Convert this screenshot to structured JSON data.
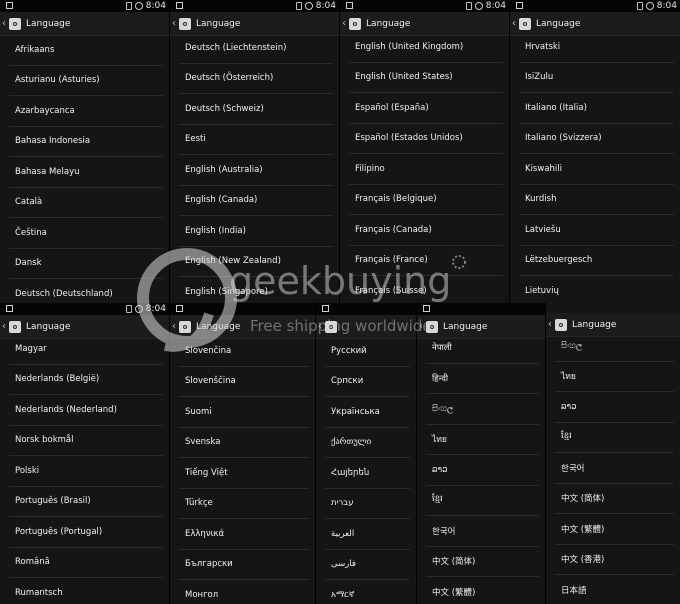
{
  "status": {
    "time": "8:04"
  },
  "actionbar": {
    "title": "Language"
  },
  "panels": [
    {
      "id": "p1",
      "items": [
        "Afrikaans",
        "Asturianu (Asturies)",
        "Azarbaycanca",
        "Bahasa Indonesia",
        "Bahasa Melayu",
        "Català",
        "Čeština",
        "Dansk",
        "Deutsch (Deutschland)"
      ]
    },
    {
      "id": "p2",
      "items": [
        "Deutsch (Liechtenstein)",
        "Deutsch (Österreich)",
        "Deutsch (Schweiz)",
        "Eesti",
        "English (Australia)",
        "English (Canada)",
        "English (India)",
        "English (New Zealand)",
        "English (Singapore)"
      ]
    },
    {
      "id": "p3",
      "items": [
        "English (United Kingdom)",
        "English (United States)",
        "Español (España)",
        "Español (Estados Unidos)",
        "Filipino",
        "Français (Belgique)",
        "Français (Canada)",
        "Français (France)",
        "Français (Suisse)"
      ]
    },
    {
      "id": "p4",
      "items": [
        "Hrvatski",
        "IsiZulu",
        "Italiano (Italia)",
        "Italiano (Svizzera)",
        "Kiswahili",
        "Kurdish",
        "Latviešu",
        "Lëtzebuergesch",
        "Lietuvių"
      ]
    },
    {
      "id": "p5",
      "items": [
        "Magyar",
        "Nederlands (België)",
        "Nederlands (Nederland)",
        "Norsk bokmål",
        "Polski",
        "Português (Brasil)",
        "Português (Portugal)",
        "Română",
        "Rumantsch"
      ]
    },
    {
      "id": "p6",
      "items": [
        "Slovenčina",
        "Slovenščina",
        "Suomi",
        "Svenska",
        "Tiếng Việt",
        "Türkçe",
        "Ελληνικά",
        "Български",
        "Монгол"
      ]
    },
    {
      "id": "p7",
      "items": [
        "Русский",
        "Српски",
        "Українська",
        "ქართული",
        "Հայերեն",
        "עברית",
        "العربية",
        "فارسی",
        "አማርኛ"
      ]
    },
    {
      "id": "p8",
      "items": [
        "नेपाली",
        "हिन्दी",
        "සිංහල",
        "ไทย",
        "ລາວ",
        "ខ្មែរ",
        "한국어",
        "中文 (简体)",
        "中文 (繁體)"
      ]
    },
    {
      "id": "p9",
      "items": [
        "සිංහල",
        "ไทย",
        "ລາວ",
        "ខ្មែរ",
        "한국어",
        "中文 (简体)",
        "中文 (繁體)",
        "中文 (香港)",
        "日本語"
      ]
    }
  ],
  "watermark": {
    "brand": "geekbuying",
    "tagline": "Free shipping worldwide"
  }
}
